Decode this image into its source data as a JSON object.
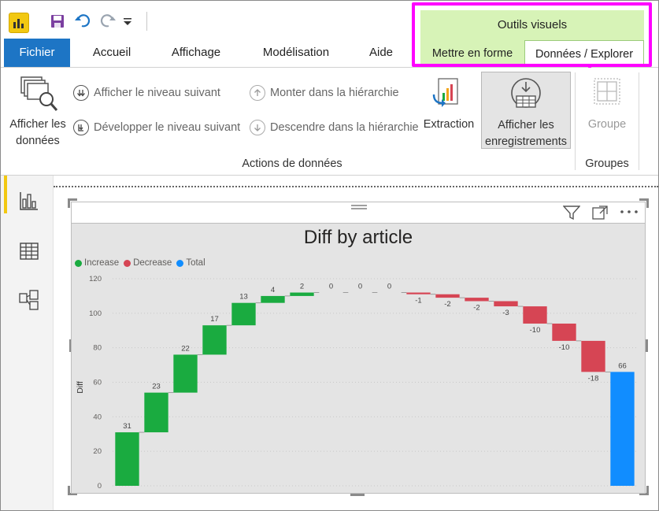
{
  "tabs": {
    "file": "Fichier",
    "home": "Accueil",
    "view": "Affichage",
    "modeling": "Modélisation",
    "help": "Aide"
  },
  "visual_tools": {
    "title": "Outils visuels",
    "format_tab": "Mettre en forme",
    "data_tab": "Données / Explorer"
  },
  "ribbon": {
    "show_data": [
      "Afficher les",
      "données"
    ],
    "next_level": "Afficher le niveau suivant",
    "expand_next": "Développer le niveau suivant",
    "drill_up": "Monter dans la hiérarchie",
    "drill_down": "Descendre dans la hiérarchie",
    "extraction": "Extraction",
    "show_records": [
      "Afficher les",
      "enregistrements"
    ],
    "group": "Groupe",
    "group_data_actions": "Actions de données",
    "group_groups": "Groupes"
  },
  "colors": {
    "accent": "#1d75c5",
    "highlight": "#ff00ff",
    "increase": "#1aab40",
    "decrease": "#d64554",
    "total": "#118dff"
  },
  "icons": [
    "power-bi-logo-icon",
    "save-icon",
    "undo-icon",
    "redo-icon",
    "customize-qat-icon",
    "report-view-icon",
    "data-view-icon",
    "model-view-icon",
    "filter-icon",
    "focus-mode-icon",
    "more-options-icon"
  ],
  "chart_data": {
    "type": "waterfall",
    "title": "Diff by article",
    "ylabel": "Diff",
    "ylim": [
      0,
      120
    ],
    "yticks": [
      0,
      20,
      40,
      60,
      80,
      100,
      120
    ],
    "legend": [
      {
        "name": "Increase",
        "color": "#1aab40"
      },
      {
        "name": "Decrease",
        "color": "#d64554"
      },
      {
        "name": "Total",
        "color": "#118dff"
      }
    ],
    "values": [
      31,
      23,
      22,
      17,
      13,
      4,
      2,
      0,
      0,
      0,
      -1,
      -2,
      -2,
      -3,
      -10,
      -10,
      -18
    ],
    "total": 66
  }
}
